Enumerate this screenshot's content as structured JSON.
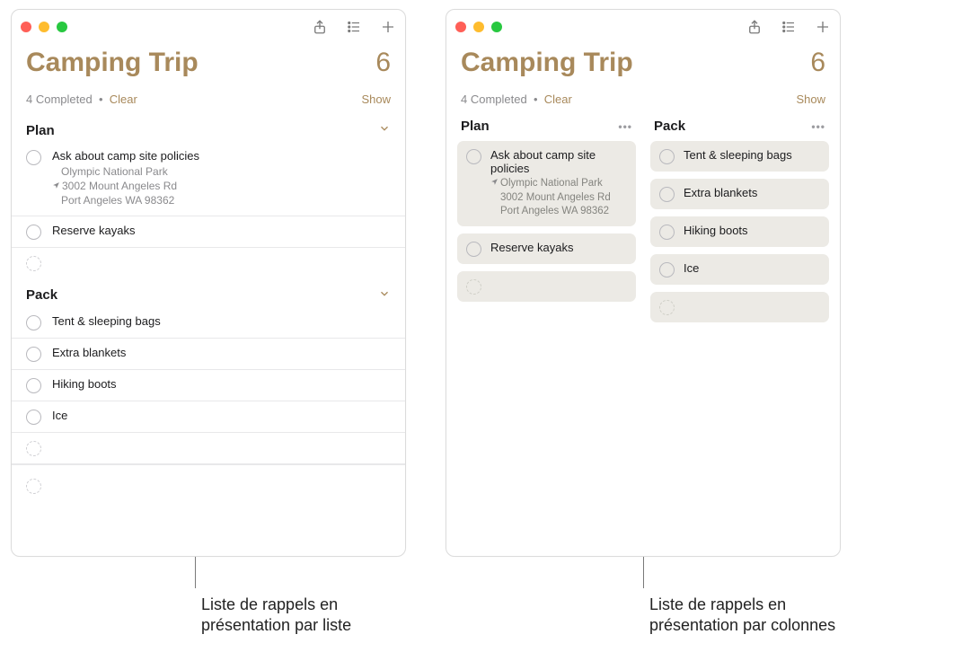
{
  "listTitle": "Camping Trip",
  "count": "6",
  "completedText": "4 Completed",
  "dot": "•",
  "clear": "Clear",
  "show": "Show",
  "sections": {
    "plan": {
      "title": "Plan",
      "items": [
        {
          "title": "Ask about camp site policies",
          "location": "Olympic National Park",
          "addr1": "3002 Mount Angeles Rd",
          "addr2": "Port Angeles WA 98362"
        },
        {
          "title": "Reserve kayaks"
        }
      ]
    },
    "pack": {
      "title": "Pack",
      "items": [
        {
          "title": "Tent & sleeping bags"
        },
        {
          "title": "Extra blankets"
        },
        {
          "title": "Hiking boots"
        },
        {
          "title": "Ice"
        }
      ]
    }
  },
  "captions": {
    "a": "Liste de rappels en présentation par liste",
    "b": "Liste de rappels en présentation par colonnes"
  }
}
